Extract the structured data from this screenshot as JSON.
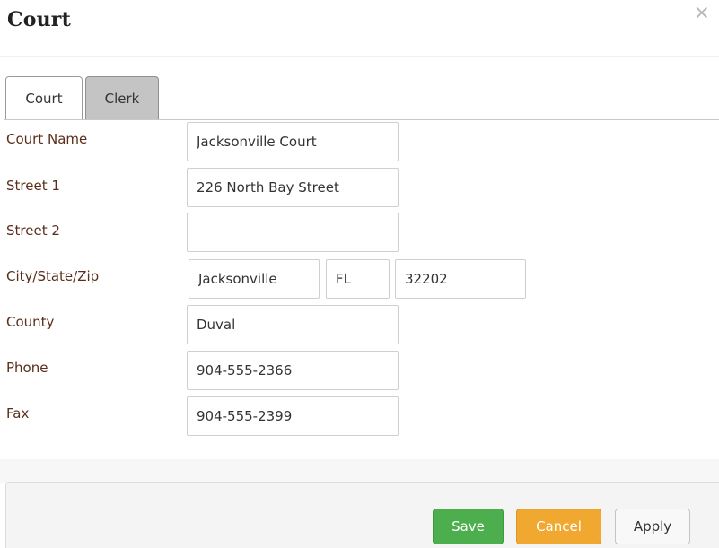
{
  "dialog": {
    "title": "Court",
    "close_symbol": "×"
  },
  "tabs": [
    {
      "label": "Court",
      "active": true
    },
    {
      "label": "Clerk",
      "active": false
    }
  ],
  "fields": {
    "court_name": {
      "label": "Court Name",
      "value": "Jacksonville Court"
    },
    "street1": {
      "label": "Street 1",
      "value": "226 North Bay Street"
    },
    "street2": {
      "label": "Street 2",
      "value": ""
    },
    "city_state_zip": {
      "label": "City/State/Zip",
      "city": "Jacksonville",
      "state": "FL",
      "zip": "32202"
    },
    "county": {
      "label": "County",
      "value": "Duval"
    },
    "phone": {
      "label": "Phone",
      "value": "904-555-2366"
    },
    "fax": {
      "label": "Fax",
      "value": "904-555-2399"
    }
  },
  "buttons": {
    "save": "Save",
    "cancel": "Cancel",
    "apply": "Apply"
  },
  "colors": {
    "label_text": "#5a2e1a",
    "save_green": "#4cae4c",
    "cancel_orange": "#f0a830"
  },
  "icons": {
    "close": "close-icon"
  }
}
